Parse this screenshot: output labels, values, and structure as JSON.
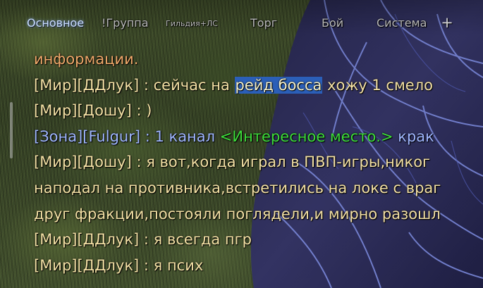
{
  "tabs": [
    {
      "label": "Основное",
      "active": true
    },
    {
      "label": "!Группа",
      "active": false
    },
    {
      "label": "Гильдия+ЛС",
      "active": false
    },
    {
      "label": "Торг",
      "active": false
    },
    {
      "label": "Бой",
      "active": false
    },
    {
      "label": "Система",
      "active": false
    }
  ],
  "tab_add_label": "+",
  "chat": {
    "lines": [
      {
        "type": "info",
        "text": "информации."
      },
      {
        "type": "say",
        "prefix": "[Мир][ДДлук] : ",
        "before": "сейчас на ",
        "selected": "рейд босса",
        "after": " хожу 1 смело"
      },
      {
        "type": "say",
        "prefix": "[Мир][Дошу] : ",
        "text": ")"
      },
      {
        "type": "zone",
        "prefix": "[Зона][Fulgur] : ",
        "before": "1 канал ",
        "link": "<Интересное место.>",
        "after": " крак"
      },
      {
        "type": "say",
        "prefix": "[Мир][Дошу] : ",
        "text": "я вот,когда играл в ПВП-игры,никог"
      },
      {
        "type": "cont",
        "text": "наподал на противника,встретились на локе с враг"
      },
      {
        "type": "cont",
        "text": "друг фракции,постояли поглядели,и мирно разошл"
      },
      {
        "type": "say",
        "prefix": "[Мир][ДДлук] : ",
        "text": "я всегда пгр"
      },
      {
        "type": "say",
        "prefix": "[Мир][ДДлук] : ",
        "text": "я псих"
      }
    ]
  },
  "colors": {
    "active_tab": "#c9dcff",
    "tab": "#b8b8b8",
    "world_chat": "#f3e0a4",
    "system_info": "#f0a96a",
    "zone_chat": "#9fb6ff",
    "zone_link": "#3ddc3a",
    "selection": "#2b5fb8"
  }
}
